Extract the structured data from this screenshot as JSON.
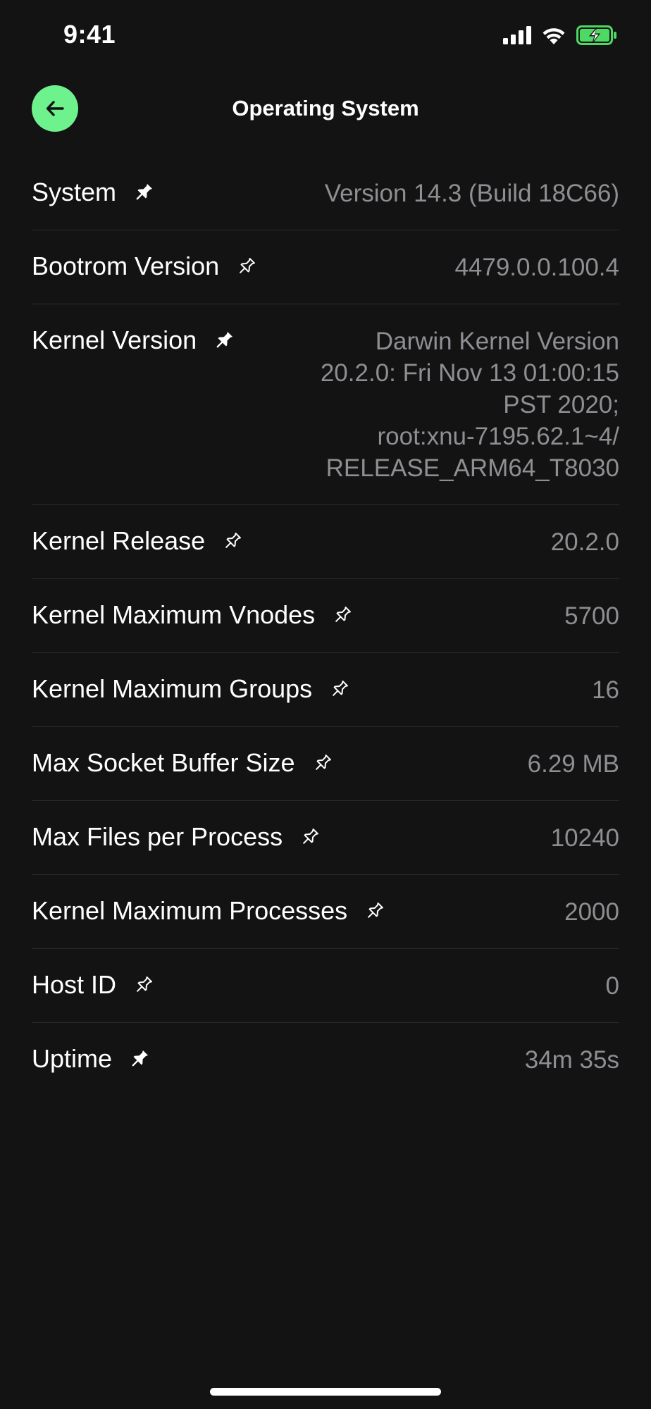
{
  "status_bar": {
    "time": "9:41"
  },
  "header": {
    "title": "Operating System"
  },
  "colors": {
    "background": "#131313",
    "accent": "#6ef28e",
    "label": "#ffffff",
    "value": "#8e8e93",
    "battery": "#4cd964"
  },
  "rows": [
    {
      "label": "System",
      "value": "Version 14.3 (Build 18C66)",
      "pinned": true
    },
    {
      "label": "Bootrom Version",
      "value": "4479.0.0.100.4",
      "pinned": false
    },
    {
      "label": "Kernel Version",
      "value": "Darwin Kernel Version\n20.2.0: Fri Nov 13 01:00:15\nPST 2020;\nroot:xnu-7195.62.1~4/\nRELEASE_ARM64_T8030",
      "pinned": true
    },
    {
      "label": "Kernel Release",
      "value": "20.2.0",
      "pinned": false
    },
    {
      "label": "Kernel Maximum Vnodes",
      "value": "5700",
      "pinned": false
    },
    {
      "label": "Kernel Maximum Groups",
      "value": "16",
      "pinned": false
    },
    {
      "label": "Max Socket Buffer Size",
      "value": "6.29 MB",
      "pinned": false
    },
    {
      "label": "Max Files per Process",
      "value": "10240",
      "pinned": false
    },
    {
      "label": "Kernel Maximum Processes",
      "value": "2000",
      "pinned": false
    },
    {
      "label": "Host ID",
      "value": "0",
      "pinned": false
    },
    {
      "label": "Uptime",
      "value": "34m 35s",
      "pinned": true
    }
  ]
}
